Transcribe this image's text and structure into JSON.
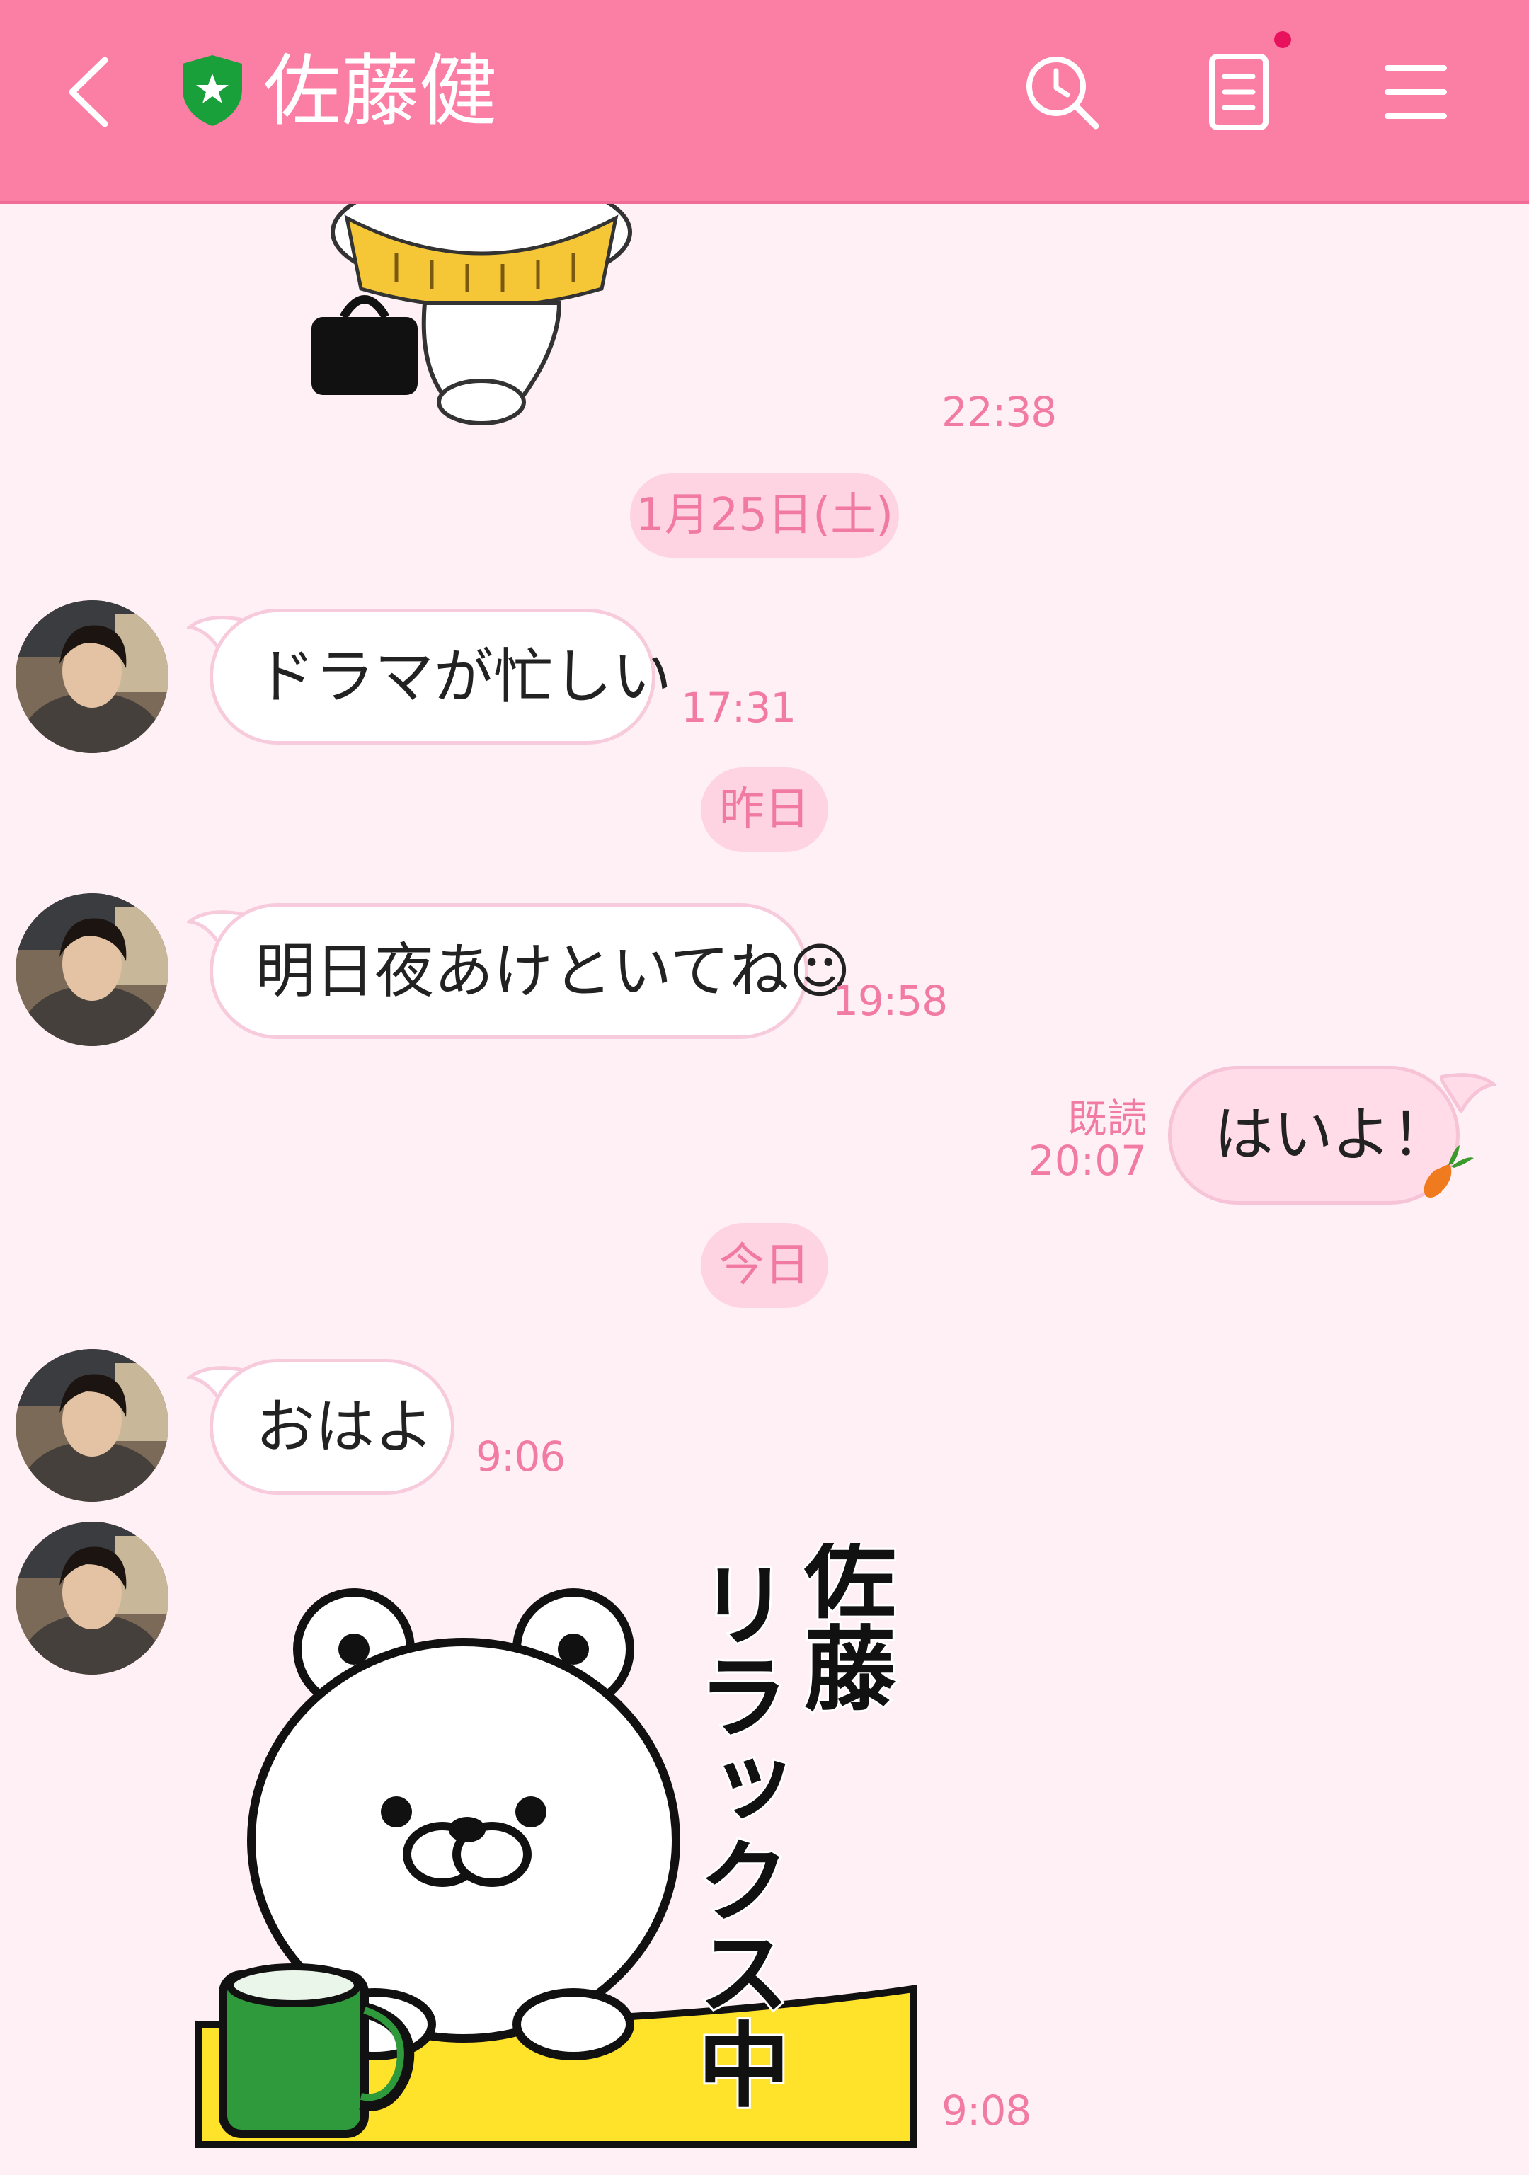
{
  "header": {
    "title": "佐藤健",
    "back_icon": "chevron-left-icon",
    "verified_icon": "green-shield-star-icon",
    "search_icon": "clock-search-icon",
    "notes_icon": "notes-icon",
    "menu_icon": "hamburger-menu-icon",
    "colors": {
      "bar": "#fb7ea5",
      "dot": "#e8125c",
      "shield": "#19a03a"
    }
  },
  "chat": {
    "sticker_top_time": "22:38",
    "date_1": "1月25日(土)",
    "msg_1": {
      "text": "ドラマが忙しい",
      "time": "17:31"
    },
    "date_2": "昨日",
    "msg_2": {
      "text": "明日夜あけといてね☺",
      "time": "19:58"
    },
    "msg_me": {
      "text": "はいよ！",
      "read_label": "既読",
      "time": "20:07"
    },
    "date_3": "今日",
    "msg_3": {
      "text": "おはよ",
      "time": "9:06"
    },
    "sticker": {
      "text_1": "佐藤",
      "text_2": "リラックス中",
      "time": "9:08"
    },
    "colors": {
      "background": "#fff0f5",
      "time_text": "#f27ba3",
      "pill": "#ffd4e2",
      "my_bubble": "#ffdce8"
    }
  }
}
